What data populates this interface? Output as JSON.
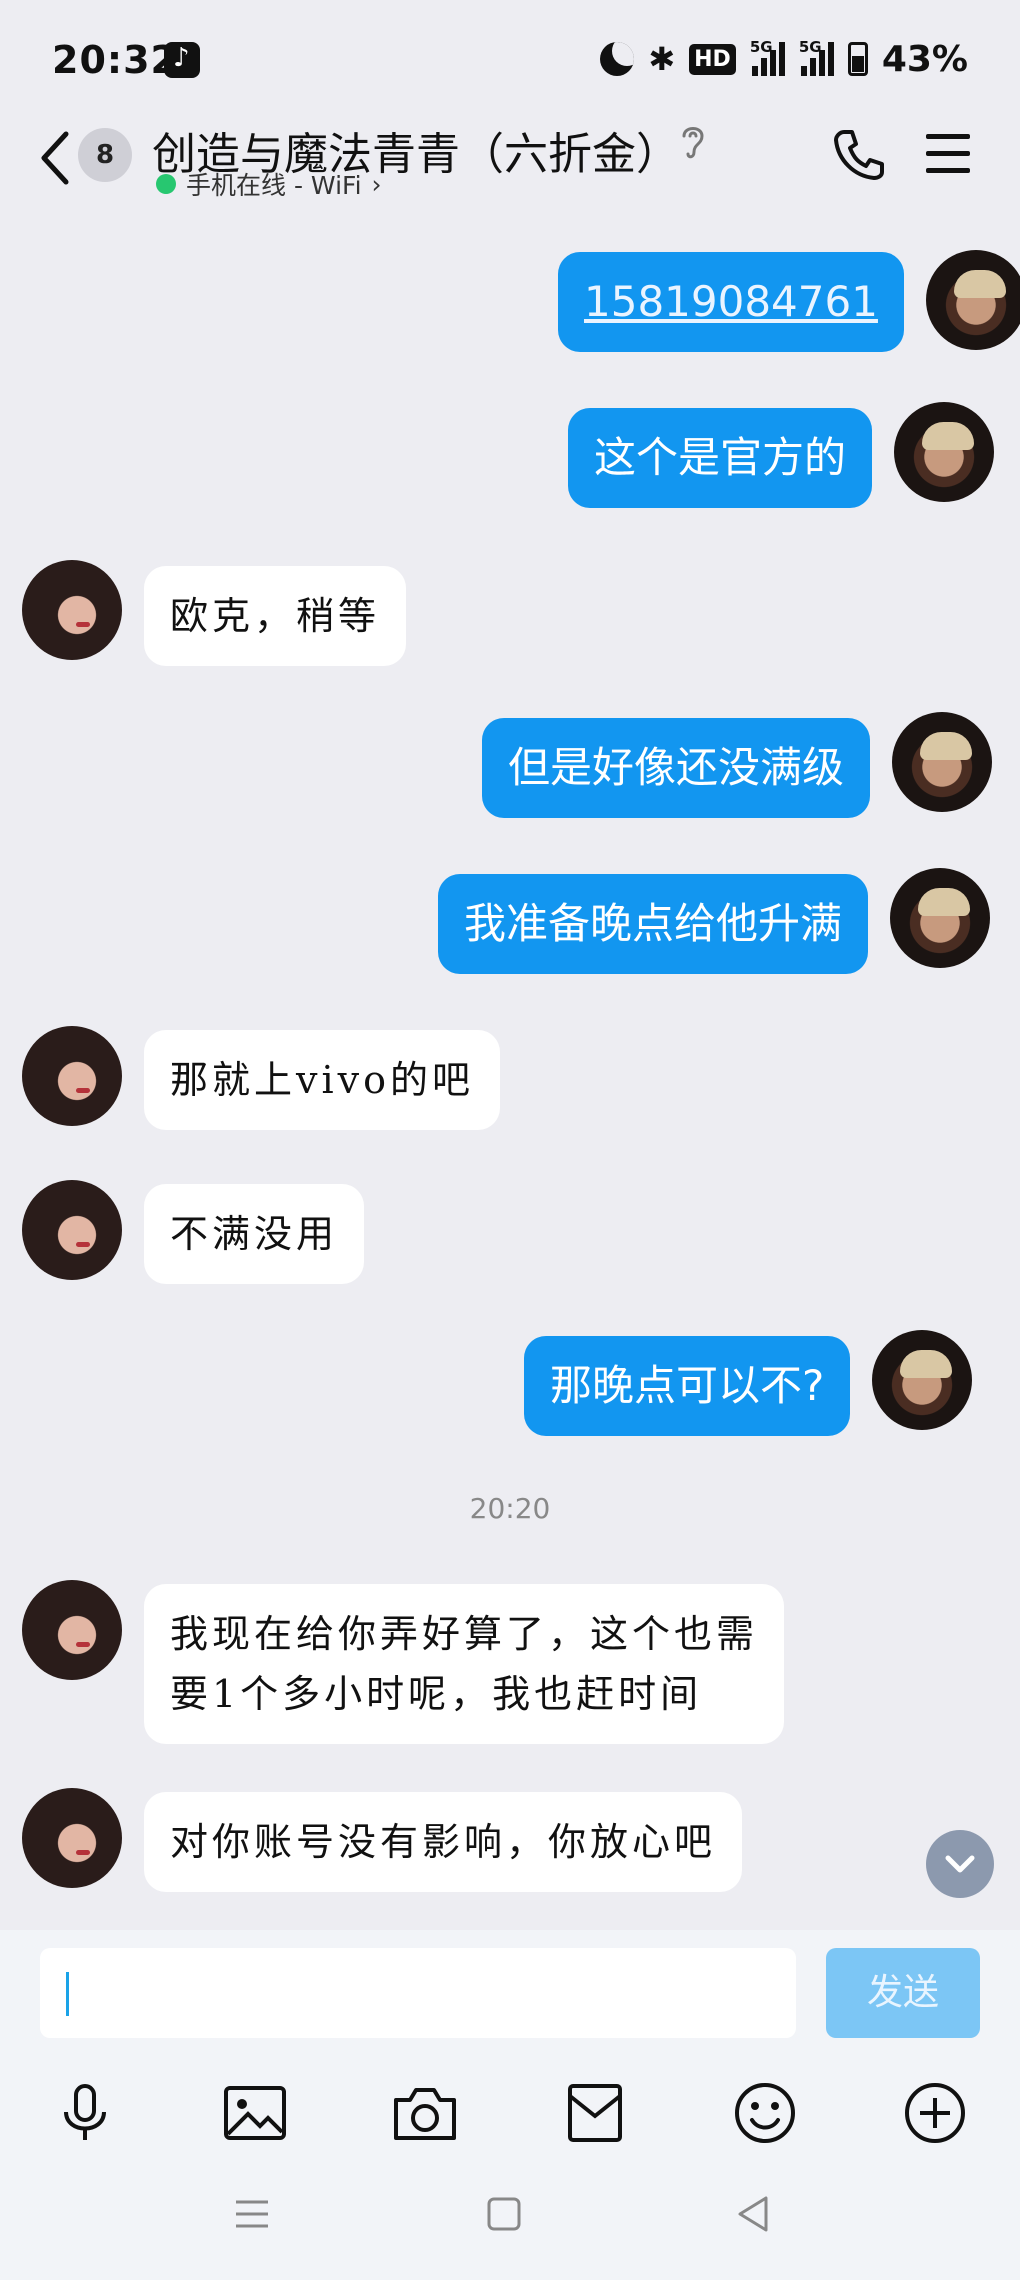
{
  "status": {
    "time": "20:32",
    "battery": "43%",
    "network": "5G",
    "hd": "HD"
  },
  "header": {
    "title": "创造与魔法青青（六折金）",
    "subtitle": "手机在线 - WiFi",
    "unread": "8"
  },
  "messages": [
    {
      "from": "me",
      "text": "15819084761",
      "link": true
    },
    {
      "from": "me",
      "text": "这个是官方的"
    },
    {
      "from": "her",
      "text": "欧克，稍等"
    },
    {
      "from": "me",
      "text": "但是好像还没满级"
    },
    {
      "from": "me",
      "text": "我准备晚点给他升满"
    },
    {
      "from": "her",
      "text": "那就上vivo的吧"
    },
    {
      "from": "her",
      "text": "不满没用"
    },
    {
      "from": "me",
      "text": "那晚点可以不?"
    },
    {
      "from": "her",
      "text_line1": "我现在给你弄好算了，这个也需",
      "text_line2": "要1个多小时呢，我也赶时间"
    },
    {
      "from": "her",
      "text": "对你账号没有影响，你放心吧"
    }
  ],
  "timestamp": "20:20",
  "input": {
    "value": "",
    "send_label": "发送"
  },
  "toolbar": [
    "mic-icon",
    "image-icon",
    "camera-icon",
    "wallet-icon",
    "emoji-icon",
    "plus-icon"
  ],
  "colors": {
    "accent": "#1296f0",
    "background": "#ededf2",
    "send_disabled": "#7cc6f5"
  }
}
